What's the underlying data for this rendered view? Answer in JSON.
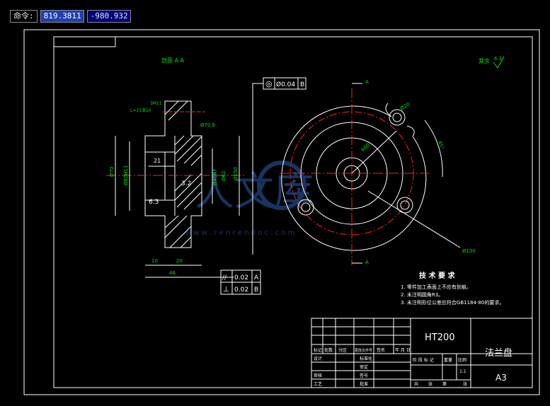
{
  "command_bar": {
    "prompt": "命令:",
    "x_value": "819.3811",
    "y_value": "-980.932"
  },
  "section_title": "剖面 A-A",
  "roughness_note": "其余",
  "roughness_value": "6.3",
  "tolerances": {
    "concentricity": {
      "symbol": "◎",
      "value": "Ø0.04",
      "datum": "B"
    },
    "parallelism": {
      "symbol": "//",
      "value": "0.02",
      "datum": "A"
    },
    "perpendicularity": {
      "symbol": "⊥",
      "value": "0.02",
      "datum": "B"
    }
  },
  "dimensions": {
    "thread": "3M11",
    "thread_depth": "L=15深10",
    "d70": "Ø70",
    "d60h": "Ø60H11",
    "d21": "21",
    "d32": "3.2",
    "d63": "6.3",
    "d40": "Ø40h7",
    "d62": "Ø62",
    "d70_6": "Ø70.6",
    "d150": "Ø150",
    "len10": "10",
    "len20": "20",
    "len46": "46",
    "r20": "Ø20",
    "r60": "R60",
    "r100": "Ø100",
    "angle": "45°"
  },
  "section_marks": {
    "top": "A",
    "bottom": "A"
  },
  "tech_requirements": {
    "title": "技 术 要 求",
    "items": [
      "1. 零件加工表面上不应有划痕。",
      "2. 未注明圆角R3。",
      "3. 未注明形位公差应符合GB1184-80的要求。"
    ]
  },
  "title_block": {
    "material": "HT200",
    "part_name": "法兰盘",
    "sheet_size": "A3",
    "scale": "1:1",
    "labels_row1": [
      "标记",
      "处数",
      "分区",
      "更改文件号",
      "签名",
      "年 月 日"
    ],
    "labels_left": [
      "设计",
      "审核",
      "工艺"
    ],
    "labels_mid": [
      "标准化",
      "审定",
      "签号",
      "批准"
    ],
    "stage_labels": [
      "阶 段 标 记",
      "重量",
      "比例"
    ],
    "sheet_row": [
      "共",
      "张",
      "第",
      "张"
    ]
  },
  "watermark": {
    "text": "人文库",
    "url": "w w w . r e n r e n d o c . c o m"
  }
}
